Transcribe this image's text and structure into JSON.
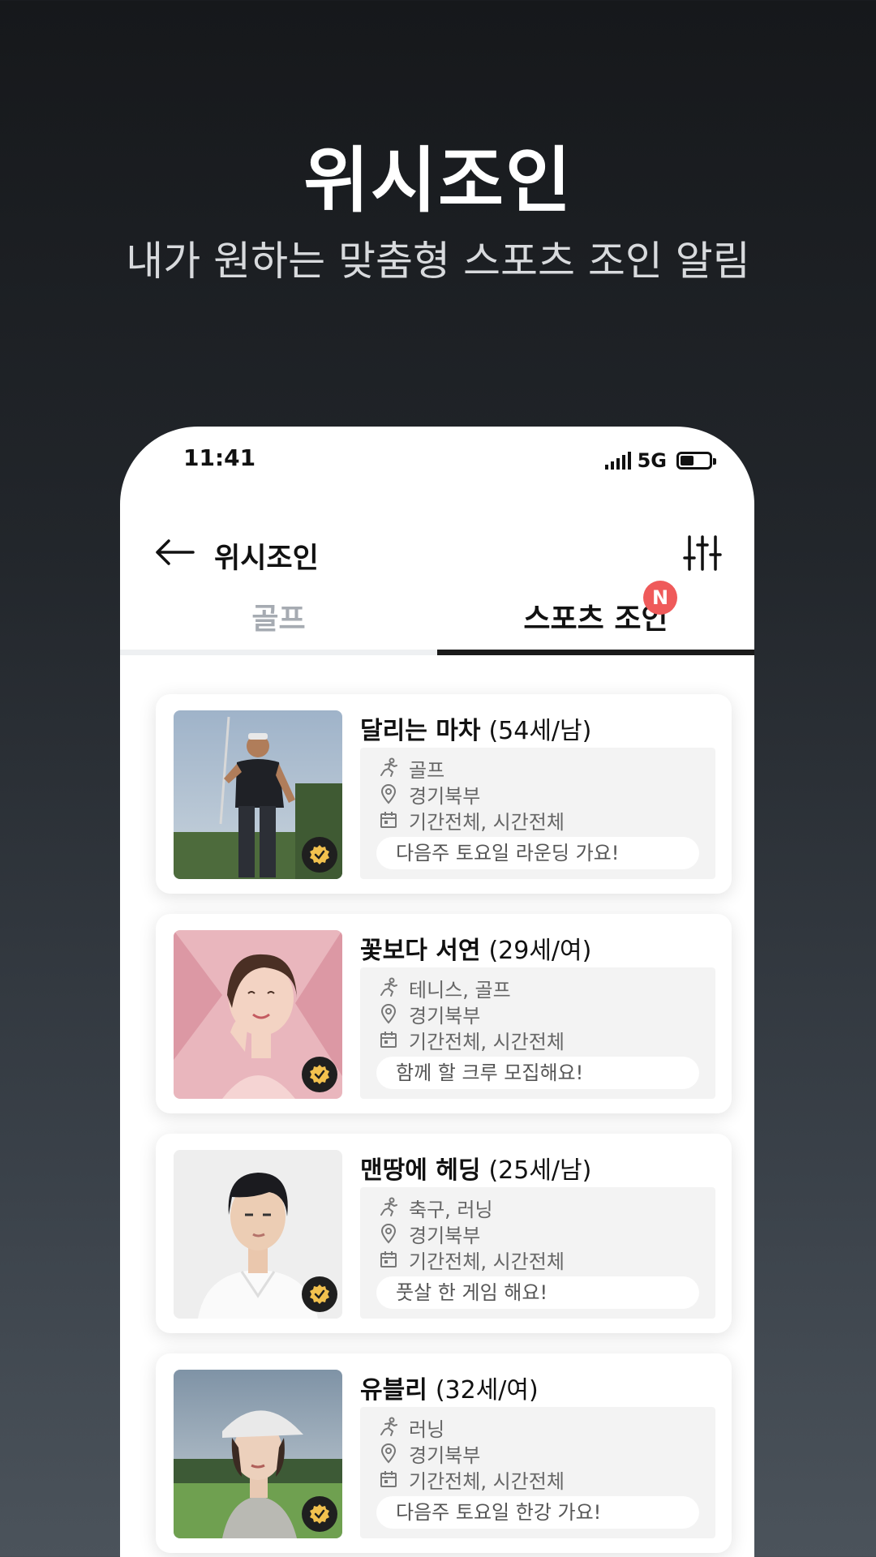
{
  "hero": {
    "title": "위시조인",
    "subtitle": "내가 원하는 맞춤형 스포츠 조인 알림"
  },
  "status_bar": {
    "time": "11:41",
    "network": "5G",
    "icons": [
      "signal-icon",
      "battery-icon"
    ]
  },
  "app_bar": {
    "title": "위시조인",
    "back_icon": "arrow-left-icon",
    "filter_icon": "sliders-icon"
  },
  "tabs": [
    {
      "label": "골프",
      "active": false
    },
    {
      "label": "스포츠 조인",
      "active": true,
      "badge": "N"
    }
  ],
  "cards": [
    {
      "nickname": "달리는 마차",
      "meta": "(54세/남)",
      "sport": "골프",
      "location": "경기북부",
      "time": "기간전체, 시간전체",
      "message": "다음주 토요일 라운딩 가요!"
    },
    {
      "nickname": "꽃보다 서연",
      "meta": "(29세/여)",
      "sport": "테니스, 골프",
      "location": "경기북부",
      "time": "기간전체, 시간전체",
      "message": "함께 할 크루 모집해요!"
    },
    {
      "nickname": "맨땅에 헤딩",
      "meta": "(25세/남)",
      "sport": "축구, 러닝",
      "location": "경기북부",
      "time": "기간전체, 시간전체",
      "message": "풋살 한 게임 해요!"
    },
    {
      "nickname": "유블리",
      "meta": "(32세/여)",
      "sport": "러닝",
      "location": "경기북부",
      "time": "기간전체, 시간전체",
      "message": "다음주 토요일 한강 가요!"
    }
  ],
  "colors": {
    "badge_red": "#ef5a5a",
    "badge_gold": "#f2c14e",
    "active_tab": "#1a1a1a",
    "inactive_tab": "#a6abb2"
  }
}
